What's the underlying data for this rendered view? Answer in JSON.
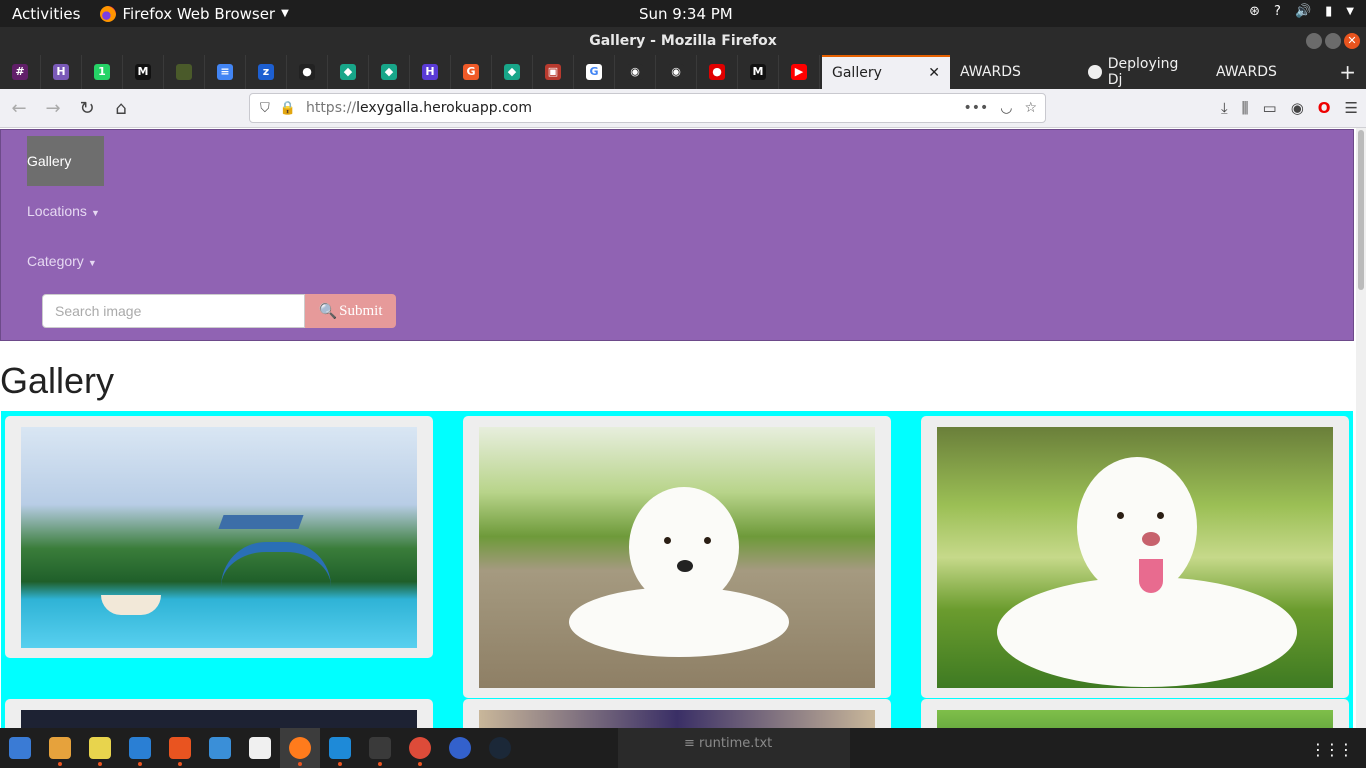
{
  "system": {
    "activities": "Activities",
    "app_menu": "Firefox Web Browser",
    "clock": "Sun  9:34 PM",
    "help": "?"
  },
  "window": {
    "title": "Gallery - Mozilla Firefox"
  },
  "tabs": {
    "pinned": [
      {
        "icon": "slack-icon",
        "color": "#611f69",
        "glyph": "#"
      },
      {
        "icon": "h-icon",
        "color": "#7a5ab8",
        "glyph": "H"
      },
      {
        "icon": "whatsapp-icon",
        "color": "#25d366",
        "glyph": "1"
      },
      {
        "icon": "medium-icon",
        "color": "#111111",
        "glyph": "M"
      },
      {
        "icon": "generic-icon",
        "color": "#4a5a2a",
        "glyph": ""
      },
      {
        "icon": "docs-icon",
        "color": "#4285f4",
        "glyph": "≡"
      },
      {
        "icon": "trello-icon",
        "color": "#1d5fd1",
        "glyph": "z"
      },
      {
        "icon": "github-dark-icon",
        "color": "#222222",
        "glyph": "●"
      },
      {
        "icon": "course-icon",
        "color": "#18a689",
        "glyph": "◆"
      },
      {
        "icon": "course-icon-2",
        "color": "#18a689",
        "glyph": "◆"
      },
      {
        "icon": "hackerrank-icon",
        "color": "#5a3bd6",
        "glyph": "H"
      },
      {
        "icon": "orange-icon",
        "color": "#f05a28",
        "glyph": "G"
      },
      {
        "icon": "course-icon-3",
        "color": "#18a689",
        "glyph": "◆"
      },
      {
        "icon": "red-app-icon",
        "color": "#b83a2e",
        "glyph": "▣"
      },
      {
        "icon": "google-icon",
        "color": "#ffffff",
        "glyph": "G"
      },
      {
        "icon": "github-icon",
        "color": "#2b2b2b",
        "glyph": "◉"
      },
      {
        "icon": "github-icon-2",
        "color": "#2b2b2b",
        "glyph": "◉"
      },
      {
        "icon": "opera-red-icon",
        "color": "#e00000",
        "glyph": "●"
      },
      {
        "icon": "medium-icon-2",
        "color": "#111111",
        "glyph": "M"
      },
      {
        "icon": "youtube-icon",
        "color": "#ff0000",
        "glyph": "▶"
      }
    ],
    "active_label": "Gallery",
    "close_glyph": "✕",
    "others": [
      "AWARDS",
      "Deploying Dj",
      "AWARDS"
    ],
    "new_tab": "+"
  },
  "navbar": {
    "url_scheme": "https://",
    "url_host": "lexygalla.herokuapp.com"
  },
  "site": {
    "brand": "Gallery",
    "nav_locations": "Locations",
    "nav_category": "Category",
    "search_placeholder": "Search image",
    "submit_label": "Submit",
    "heading": "Gallery"
  },
  "taskbar": {
    "runtime_label": "runtime.txt",
    "apps": [
      {
        "name": "thunderbird-icon",
        "color": "#3a7bd5"
      },
      {
        "name": "files-icon",
        "color": "#e6a23c"
      },
      {
        "name": "rhythmbox-icon",
        "color": "#e8d44d"
      },
      {
        "name": "writer-icon",
        "color": "#2a7fd4"
      },
      {
        "name": "software-icon",
        "color": "#e95420"
      },
      {
        "name": "help-app-icon",
        "color": "#3a8fd8"
      },
      {
        "name": "amazon-icon",
        "color": "#f0f0f0"
      },
      {
        "name": "firefox-taskbar-icon",
        "color": "#ff7b1c"
      },
      {
        "name": "vscode-icon",
        "color": "#1e8ad8"
      },
      {
        "name": "terminal-icon",
        "color": "#3a3a3a"
      },
      {
        "name": "chrome-icon",
        "color": "#dd4b39"
      },
      {
        "name": "simplenote-icon",
        "color": "#3361cc"
      },
      {
        "name": "steam-icon",
        "color": "#1b2838"
      }
    ]
  },
  "colors": {
    "site_nav_bg": "#9063b3",
    "gallery_bg": "#00ffff",
    "submit_bg": "#e69a9a",
    "active_tab_accent": "#e66000"
  }
}
